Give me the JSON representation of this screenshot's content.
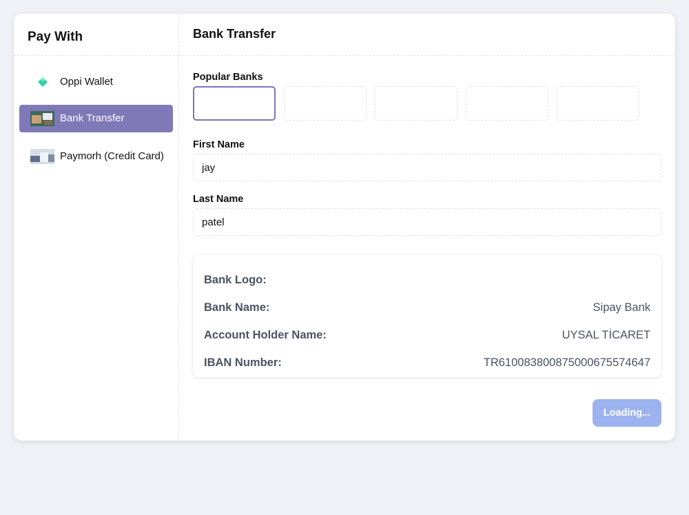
{
  "sidebar": {
    "title": "Pay With",
    "methods": [
      {
        "label": "Oppi Wallet",
        "icon": "wallet-icon",
        "active": false
      },
      {
        "label": "Bank Transfer",
        "icon": "bank-transfer-thumbnail",
        "active": true
      },
      {
        "label": "Paymorh (Credit Card)",
        "icon": "credit-card-thumbnail",
        "active": false
      }
    ]
  },
  "main": {
    "title": "Bank Transfer",
    "popular_banks_label": "Popular Banks",
    "first_name_label": "First Name",
    "first_name_value": "jay",
    "last_name_label": "Last Name",
    "last_name_value": "patel",
    "info": {
      "bank_logo_label": "Bank Logo:",
      "bank_name_label": "Bank Name:",
      "bank_name_value": "Sipay Bank",
      "holder_label": "Account Holder Name:",
      "holder_value": "UYSAL TİCARET",
      "iban_label": "IBAN Number:",
      "iban_value": "TR610083800875000675574647"
    },
    "submit_label": "Loading..."
  },
  "colors": {
    "background": "#eef1f6",
    "active_method": "#8079b8",
    "selected_bank_border": "#7d75b4",
    "button_disabled": "#9cb3ef",
    "wallet_icon": "#2fd4a6"
  }
}
